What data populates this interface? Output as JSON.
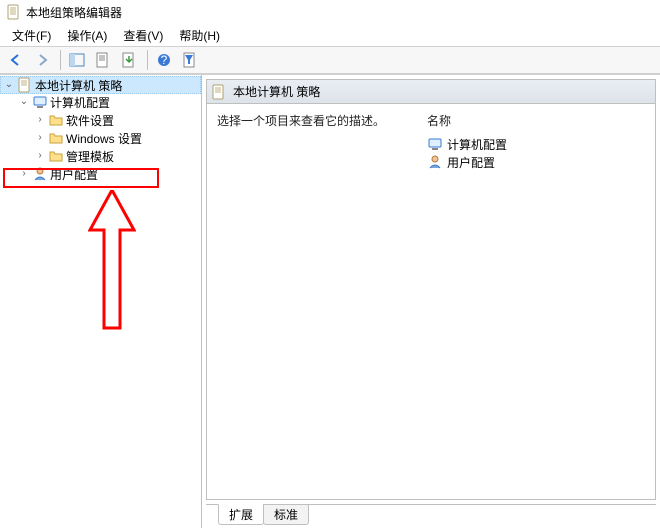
{
  "window": {
    "title": "本地组策略编辑器"
  },
  "menu": {
    "file": "文件(F)",
    "action": "操作(A)",
    "view": "查看(V)",
    "help": "帮助(H)"
  },
  "tree": {
    "root": "本地计算机 策略",
    "computer_cfg": "计算机配置",
    "software_settings": "软件设置",
    "windows_settings": "Windows 设置",
    "admin_templates": "管理模板",
    "user_cfg": "用户配置"
  },
  "detail": {
    "header": "本地计算机 策略",
    "hint": "选择一个项目来查看它的描述。",
    "col_name": "名称",
    "items": {
      "computer_cfg": "计算机配置",
      "user_cfg": "用户配置"
    }
  },
  "tabs": {
    "extended": "扩展",
    "standard": "标准"
  }
}
